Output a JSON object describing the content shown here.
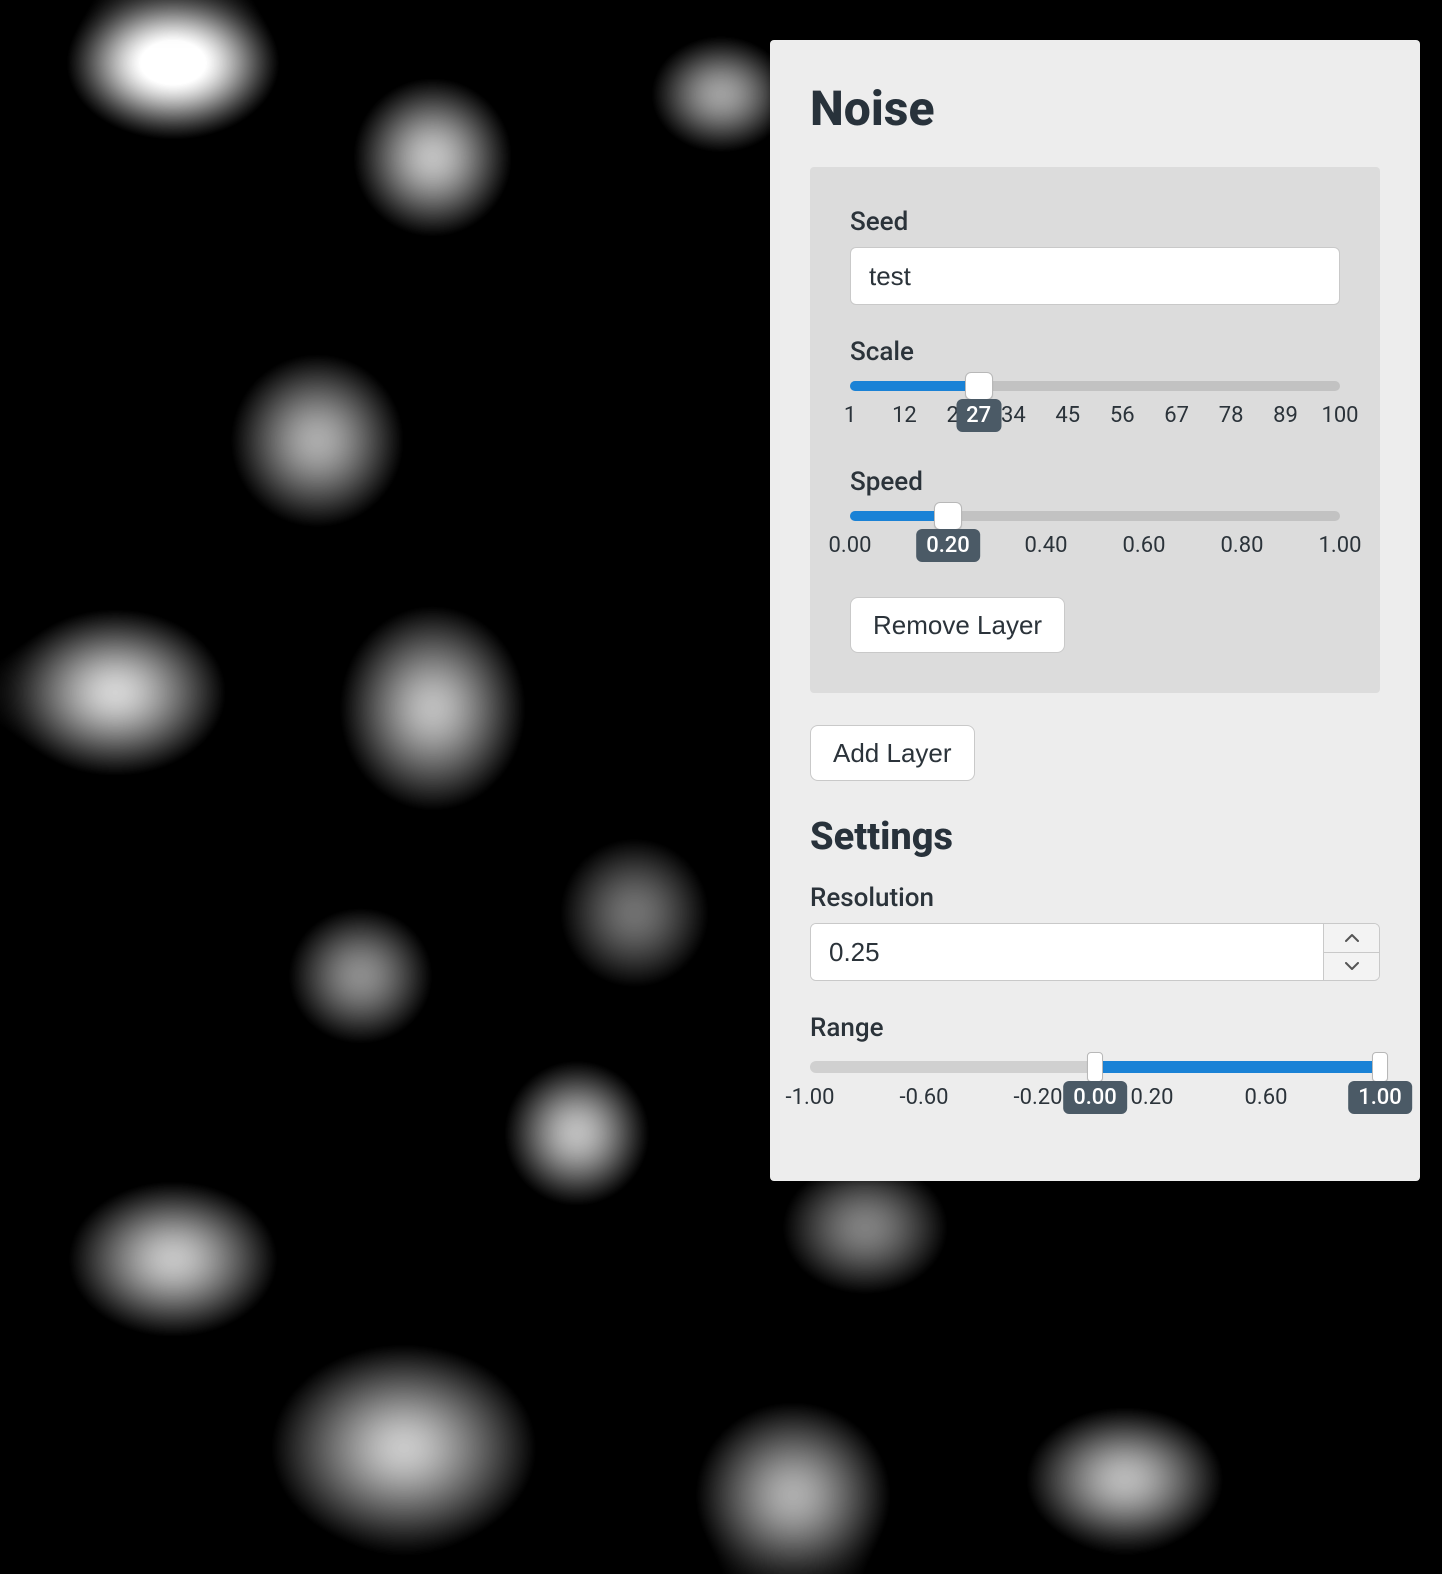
{
  "panel": {
    "noise_title": "Noise",
    "settings_title": "Settings"
  },
  "layer": {
    "seed_label": "Seed",
    "seed_value": "test",
    "scale_label": "Scale",
    "scale_value": 27,
    "scale_min": 1,
    "scale_max": 100,
    "scale_ticks": [
      "1",
      "12",
      "23",
      "34",
      "45",
      "56",
      "67",
      "78",
      "89",
      "100"
    ],
    "speed_label": "Speed",
    "speed_value": 0.2,
    "speed_min": 0.0,
    "speed_max": 1.0,
    "speed_value_display": "0.20",
    "speed_ticks": [
      "0.00",
      "0.20",
      "0.40",
      "0.60",
      "0.80",
      "1.00"
    ],
    "remove_label": "Remove Layer"
  },
  "actions": {
    "add_layer_label": "Add Layer"
  },
  "settings": {
    "resolution_label": "Resolution",
    "resolution_value": "0.25",
    "range_label": "Range",
    "range_min": -1.0,
    "range_max": 1.0,
    "range_low": 0.0,
    "range_high": 1.0,
    "range_low_display": "0.00",
    "range_high_display": "1.00",
    "range_ticks": [
      "-1.00",
      "-0.60",
      "-0.20",
      "0.20",
      "0.60",
      "1.00"
    ]
  }
}
